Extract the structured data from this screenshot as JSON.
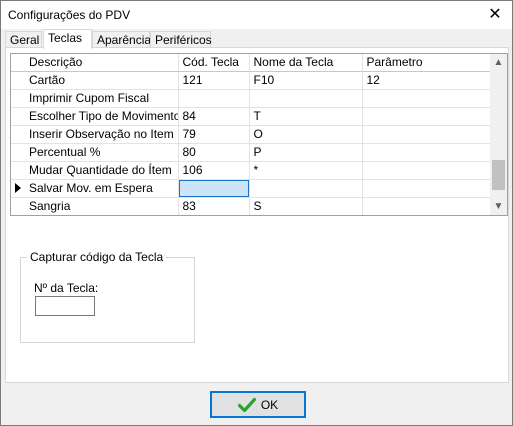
{
  "window": {
    "title": "Configurações do PDV",
    "close_glyph": "✕"
  },
  "tabs": [
    {
      "label": "Geral",
      "active": false
    },
    {
      "label": "Teclas",
      "active": true
    },
    {
      "label": "Aparência",
      "active": false
    },
    {
      "label": "Periféricos",
      "active": false
    }
  ],
  "grid": {
    "columns": [
      "Descrição",
      "Cód. Tecla",
      "Nome da Tecla",
      "Parâmetro"
    ],
    "rows": [
      {
        "descricao": "Cartão",
        "cod": "121",
        "nome": "F10",
        "param": "12",
        "current": false
      },
      {
        "descricao": "Imprimir Cupom Fiscal",
        "cod": "",
        "nome": "",
        "param": "",
        "current": false
      },
      {
        "descricao": "Escolher Tipo de Movimento",
        "cod": "84",
        "nome": "T",
        "param": "",
        "current": false
      },
      {
        "descricao": "Inserir Observação no Item",
        "cod": "79",
        "nome": "O",
        "param": "",
        "current": false
      },
      {
        "descricao": "Percentual %",
        "cod": "80",
        "nome": "P",
        "param": "",
        "current": false
      },
      {
        "descricao": "Mudar Quantidade do Ítem",
        "cod": "106",
        "nome": "*",
        "param": "",
        "current": false
      },
      {
        "descricao": "Salvar Mov. em Espera",
        "cod": "",
        "nome": "",
        "param": "",
        "current": true
      },
      {
        "descricao": "Sangria",
        "cod": "83",
        "nome": "S",
        "param": "",
        "current": false
      }
    ],
    "scroll_position": 0.8
  },
  "capture_group": {
    "title": "Capturar código da Tecla",
    "field_label": "Nº da Tecla:",
    "field_value": ""
  },
  "footer": {
    "ok_label": "OK",
    "ok_icon": "green-check-icon"
  },
  "colors": {
    "focus_blue": "#0078d7",
    "edit_cell": "#cce4f7",
    "check_green": "#2ea02e"
  }
}
